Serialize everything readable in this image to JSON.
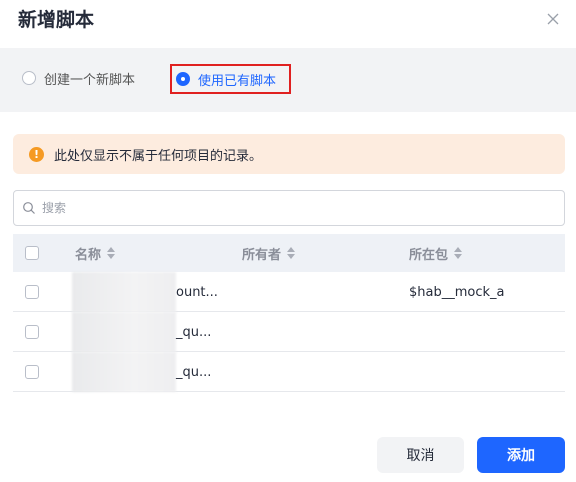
{
  "dialog": {
    "title": "新增脚本"
  },
  "mode": {
    "options": [
      {
        "label": "创建一个新脚本",
        "checked": false
      },
      {
        "label": "使用已有脚本",
        "checked": true
      }
    ]
  },
  "notice": {
    "icon": "!",
    "text": "此处仅显示不属于任何项目的记录。"
  },
  "search": {
    "placeholder": "搜索",
    "value": ""
  },
  "table": {
    "columns": [
      "名称",
      "所有者",
      "所在包"
    ],
    "rows": [
      {
        "name": "ount...",
        "owner": "",
        "package": "$hab__mock_a"
      },
      {
        "name": "_qu...",
        "owner": "",
        "package": ""
      },
      {
        "name": "_qu...",
        "owner": "",
        "package": ""
      }
    ]
  },
  "footer": {
    "cancel_label": "取消",
    "add_label": "添加"
  },
  "colors": {
    "primary": "#1e66ff",
    "highlight_border": "#e02020",
    "notice_bg": "#fdecdf",
    "notice_icon": "#f59a23"
  }
}
